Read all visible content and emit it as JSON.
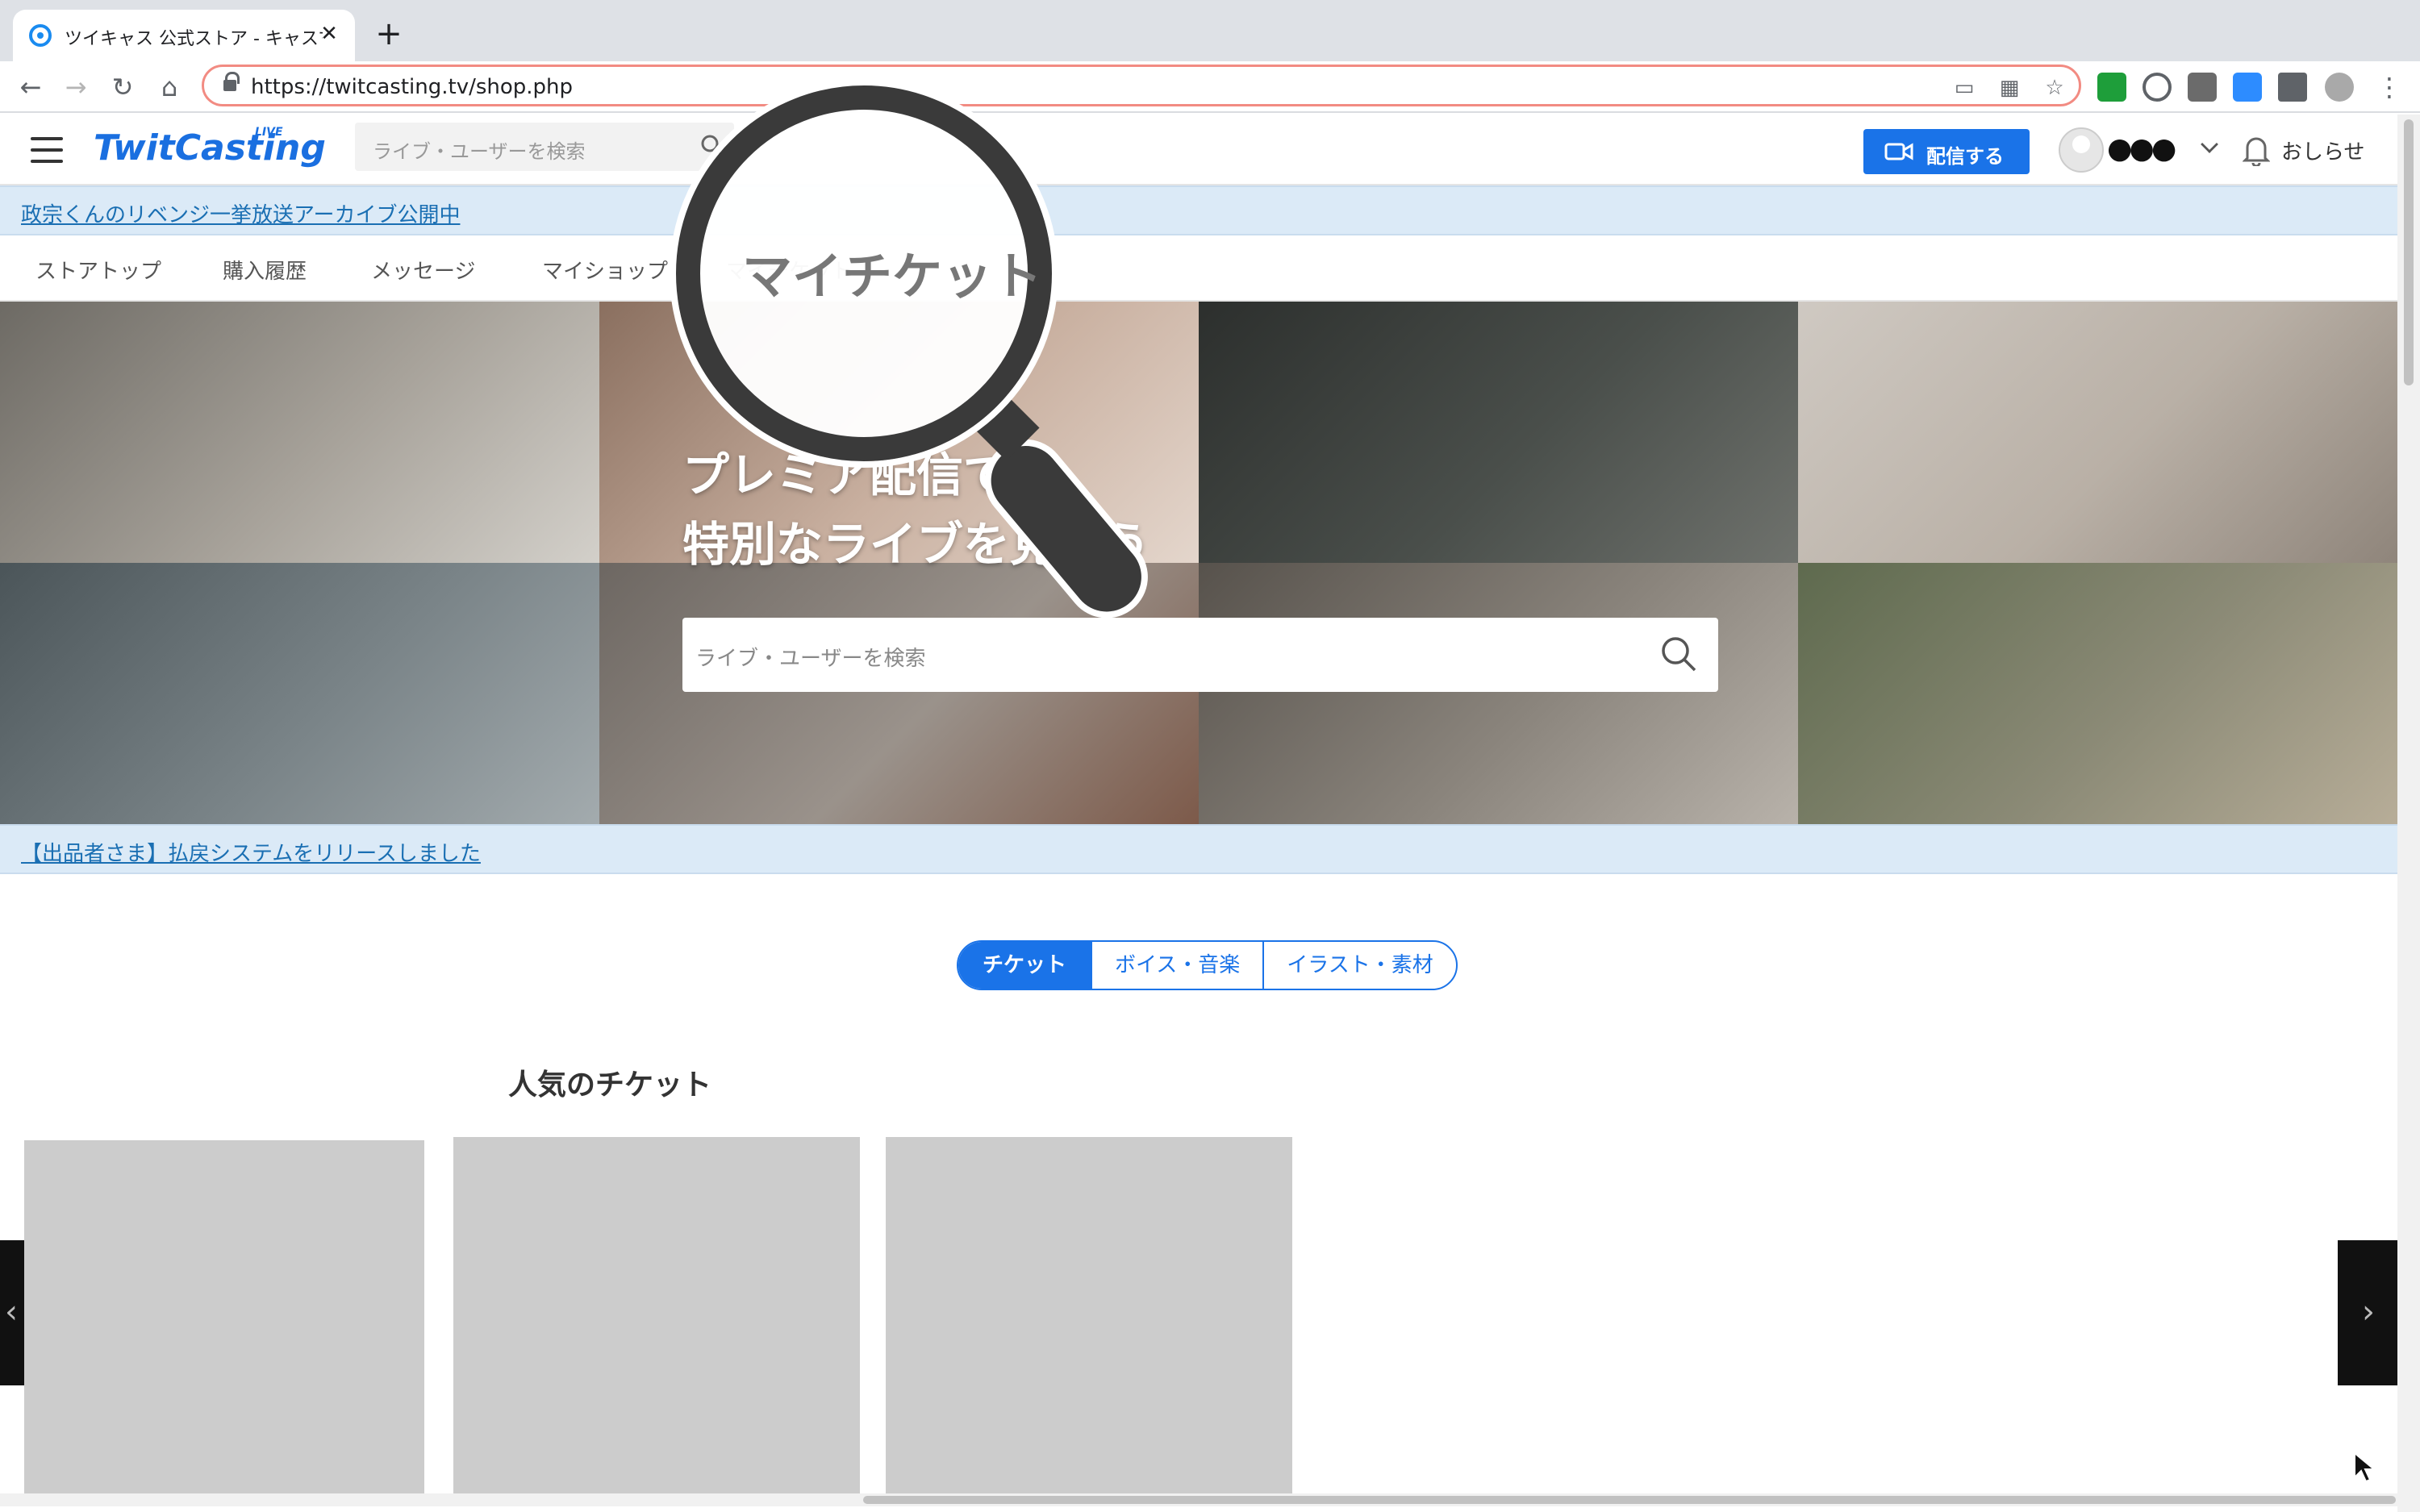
{
  "browser": {
    "tab_title": "ツイキャス 公式ストア - キャスマ",
    "url": "https://twitcasting.tv/shop.php"
  },
  "header": {
    "logo": "TwitCasting",
    "logo_badge": "LIVE",
    "search_placeholder": "ライブ・ユーザーを検索",
    "broadcast_label": "配信する",
    "user_name": "●●●",
    "notice_label": "おしらせ"
  },
  "announcement_top": "政宗くんのリベンジ一挙放送アーカイブ公開中",
  "subnav": {
    "items": [
      "ストアトップ",
      "購入履歴",
      "メッセージ",
      "マイショップ",
      "マイチケット"
    ]
  },
  "hero": {
    "line1": "プレミア配信で",
    "line2": "特別なライブを見よう",
    "search_placeholder": "ライブ・ユーザーを検索"
  },
  "announcement_bottom": "【出品者さま】払戻システムをリリースしました",
  "categories": [
    "チケット",
    "ボイス・音楽",
    "イラスト・素材"
  ],
  "section_title": "人気のチケット",
  "magnifier_label": "マイチケット",
  "colors": {
    "accent": "#1a73e8",
    "info_bar": "#dbeaf7",
    "link": "#1a6fb3",
    "card_placeholder": "#cccccc"
  }
}
